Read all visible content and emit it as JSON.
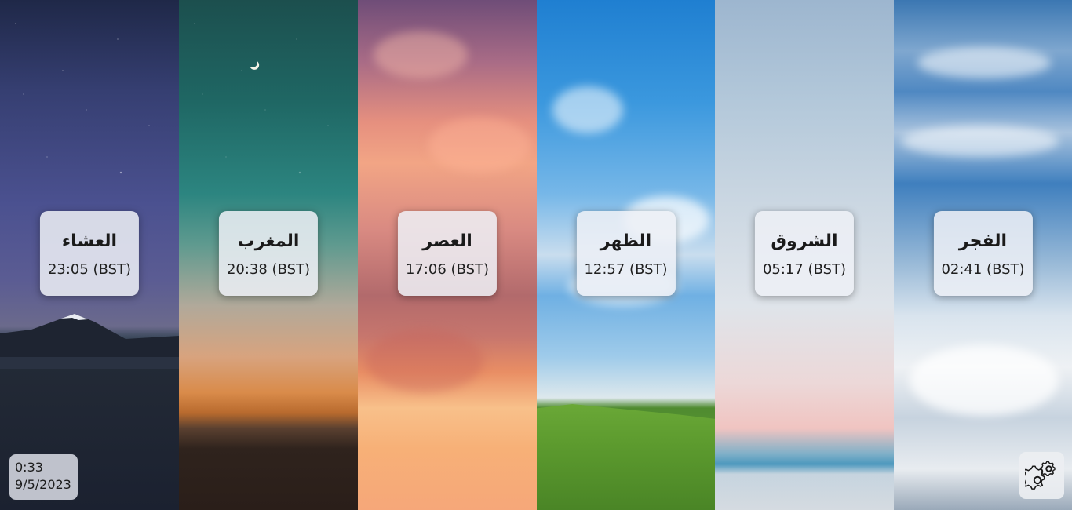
{
  "prayers": [
    {
      "name": "العشاء",
      "time": "(BST) 23:05"
    },
    {
      "name": "المغرب",
      "time": "(BST) 20:38"
    },
    {
      "name": "العصر",
      "time": "(BST) 17:06"
    },
    {
      "name": "الظهر",
      "time": "(BST) 12:57"
    },
    {
      "name": "الشروق",
      "time": "(BST) 05:17"
    },
    {
      "name": "الفجر",
      "time": "(BST) 02:41"
    }
  ],
  "clock": {
    "time": "0:33",
    "date": "9/5/2023"
  },
  "settings": {
    "icon": "gear-icon"
  },
  "colors": {
    "card_background": "#eef0f6",
    "text": "#1a1a1a"
  }
}
